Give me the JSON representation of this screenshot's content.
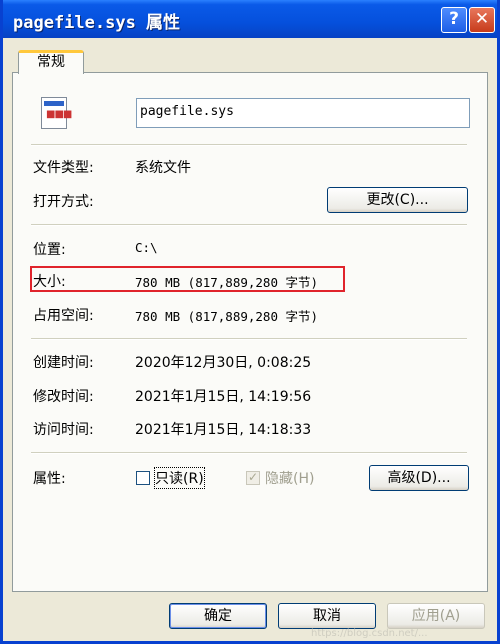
{
  "window": {
    "title": "pagefile.sys 属性",
    "help_glyph": "?",
    "close_glyph": "✕"
  },
  "tabs": [
    {
      "label": "常规"
    }
  ],
  "general": {
    "filename": "pagefile.sys",
    "type_label": "文件类型:",
    "type_value": "系统文件",
    "open_with_label": "打开方式:",
    "change_button": "更改(C)...",
    "location_label": "位置:",
    "location_value": "C:\\",
    "size_label": "大小:",
    "size_value": "780 MB (817,889,280 字节)",
    "size_on_disk_label": "占用空间:",
    "size_on_disk_value": "780 MB (817,889,280 字节)",
    "created_label": "创建时间:",
    "created_value": "2020年12月30日, 0:08:25",
    "modified_label": "修改时间:",
    "modified_value": "2021年1月15日, 14:19:56",
    "accessed_label": "访问时间:",
    "accessed_value": "2021年1月15日, 14:18:33",
    "attributes_label": "属性:",
    "readonly_label": "只读(R)",
    "readonly_checked": false,
    "hidden_label": "隐藏(H)",
    "hidden_checked": true,
    "advanced_button": "高级(D)..."
  },
  "footer": {
    "ok": "确定",
    "cancel": "取消",
    "apply": "应用(A)"
  },
  "watermark": "https://blog.csdn.net/..."
}
